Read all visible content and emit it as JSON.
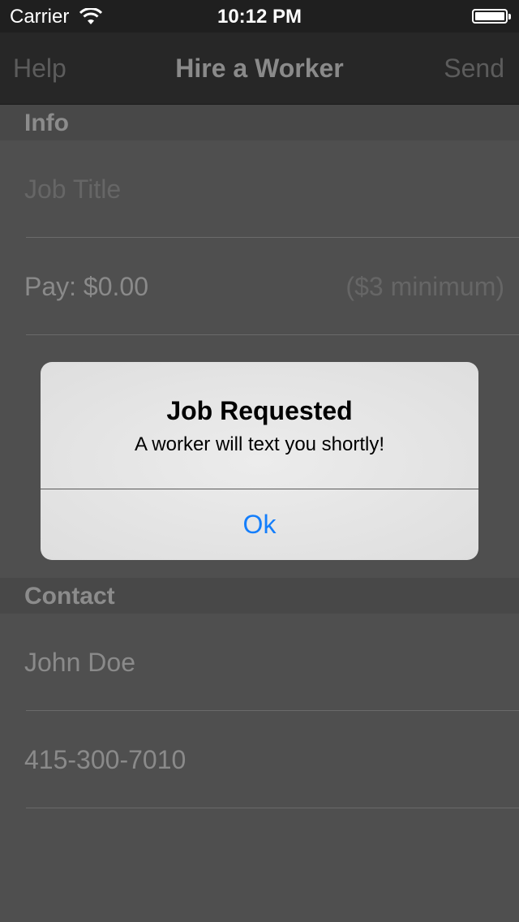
{
  "status_bar": {
    "carrier": "Carrier",
    "time": "10:12 PM",
    "wifi_icon": "wifi-icon",
    "battery_icon": "battery-icon"
  },
  "nav": {
    "left": "Help",
    "title": "Hire a Worker",
    "right": "Send"
  },
  "info_section": {
    "header": "Info",
    "job_title_placeholder": "Job Title",
    "pay_value": "Pay: $0.00",
    "pay_hint": "($3 minimum)"
  },
  "contact_section": {
    "header": "Contact",
    "name": "John Doe",
    "phone": "415-300-7010"
  },
  "alert": {
    "title": "Job Requested",
    "message": "A worker will text you shortly!",
    "button": "Ok"
  },
  "colors": {
    "alert_button": "#147efb",
    "background": "#4f4f4f",
    "navbar": "#272727"
  }
}
